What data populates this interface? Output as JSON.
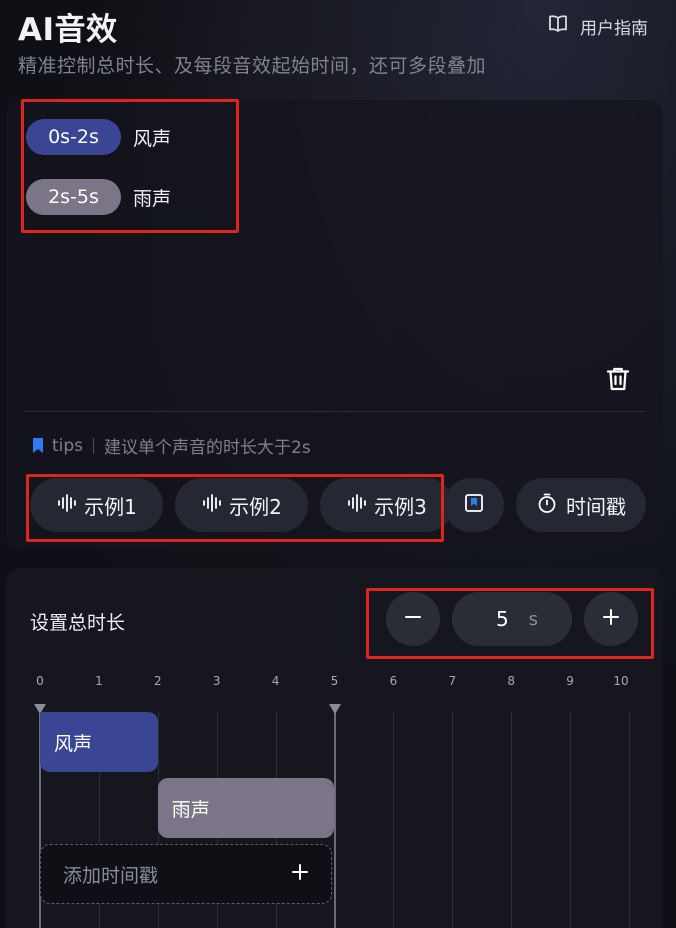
{
  "header": {
    "title": "AI音效",
    "subtitle": "精准控制总时长、及每段音效起始时间，还可多段叠加",
    "guide_label": "用户指南"
  },
  "segments": [
    {
      "range": "0s-2s",
      "label": "风声",
      "color": "#3a4594"
    },
    {
      "range": "2s-5s",
      "label": "雨声",
      "color": "#7c7587"
    }
  ],
  "tips": {
    "tag": "tips",
    "text": "建议单个声音的时长大于2s"
  },
  "examples": [
    {
      "label": "示例1"
    },
    {
      "label": "示例2"
    },
    {
      "label": "示例3"
    }
  ],
  "timestamp_button": "时间戳",
  "duration": {
    "title": "设置总时长",
    "value": "5",
    "unit": "s",
    "max": 10
  },
  "timeline": {
    "ticks": [
      "0",
      "1",
      "2",
      "3",
      "4",
      "5",
      "6",
      "7",
      "8",
      "9",
      "10"
    ],
    "tracks": [
      {
        "label": "风声",
        "start": 0,
        "end": 2,
        "color": "#3a4594"
      },
      {
        "label": "雨声",
        "start": 2,
        "end": 5,
        "color": "#7c7587"
      }
    ],
    "add_label": "添加时间戳"
  },
  "colors": {
    "accent_blue": "#3a4594",
    "accent_mauve": "#7c7587",
    "highlight_red": "#e0241c",
    "bookmark_blue": "#2f7bf6"
  }
}
